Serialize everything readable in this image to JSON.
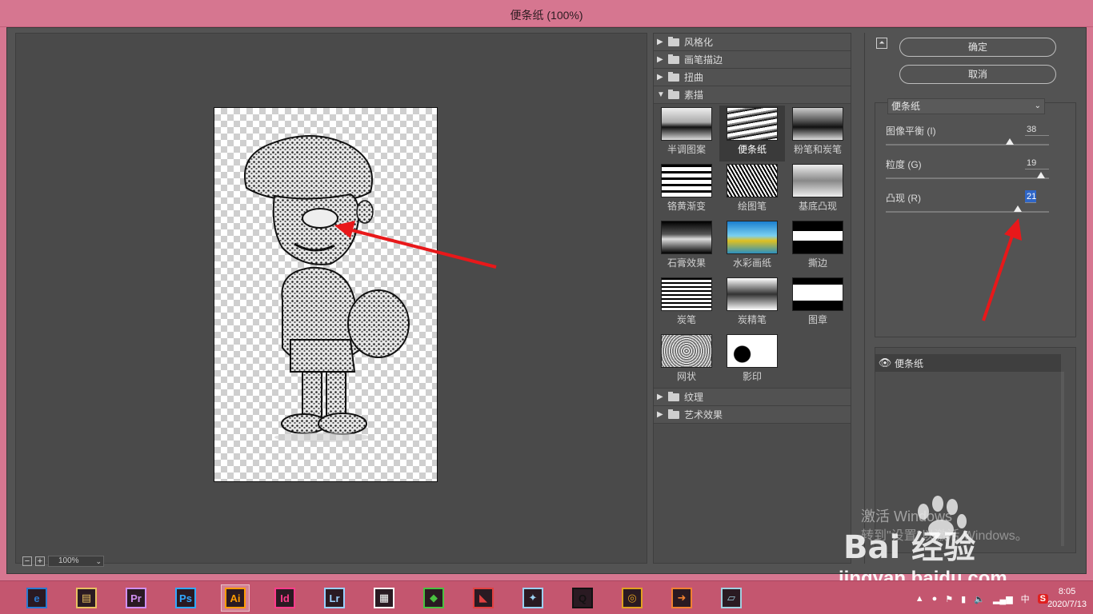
{
  "window": {
    "title": "便条纸 (100%)"
  },
  "preview": {
    "zoom": "100%",
    "zoom_out": "−",
    "zoom_in": "+"
  },
  "gallery": {
    "categories_top": [
      {
        "label": "风格化",
        "expanded": false
      },
      {
        "label": "画笔描边",
        "expanded": false
      },
      {
        "label": "扭曲",
        "expanded": false
      },
      {
        "label": "素描",
        "expanded": true
      }
    ],
    "filters": [
      {
        "label": "半调图案"
      },
      {
        "label": "便条纸",
        "selected": true
      },
      {
        "label": "粉笔和炭笔"
      },
      {
        "label": "铬黄渐变"
      },
      {
        "label": "绘图笔"
      },
      {
        "label": "基底凸现"
      },
      {
        "label": "石膏效果"
      },
      {
        "label": "水彩画纸"
      },
      {
        "label": "撕边"
      },
      {
        "label": "炭笔"
      },
      {
        "label": "炭精笔"
      },
      {
        "label": "图章"
      },
      {
        "label": "网状"
      },
      {
        "label": "影印"
      }
    ],
    "categories_bottom": [
      {
        "label": "纹理",
        "expanded": false
      },
      {
        "label": "艺术效果",
        "expanded": false
      }
    ]
  },
  "panel": {
    "ok_label": "确定",
    "cancel_label": "取消",
    "collapse_glyph": "⏶",
    "filter_select": "便条纸",
    "params": [
      {
        "label": "图像平衡 (I)",
        "value": "38",
        "fraction": 0.76
      },
      {
        "label": "粒度 (G)",
        "value": "19",
        "fraction": 0.95
      },
      {
        "label": "凸现 (R)",
        "value": "21",
        "fraction": 0.81,
        "active": true
      }
    ],
    "layer": {
      "name": "便条纸",
      "visible": true
    }
  },
  "watermark": {
    "activate": "激活 Windows",
    "activate_sub": "转到\"设置\"以激活 Windows。",
    "brand": "Bai  经验",
    "url": "jingyan.baidu.com"
  },
  "taskbar": {
    "apps": [
      {
        "name": "browser-360",
        "label": "e",
        "color": "#2a7ad0"
      },
      {
        "name": "file-explorer",
        "label": "▤",
        "color": "#e8c060"
      },
      {
        "name": "premiere",
        "label": "Pr",
        "color": "#d08ff0"
      },
      {
        "name": "photoshop",
        "label": "Ps",
        "color": "#31a8ff"
      },
      {
        "name": "illustrator",
        "label": "Ai",
        "color": "#ff9a00",
        "active": true
      },
      {
        "name": "indesign",
        "label": "Id",
        "color": "#ff3a8a"
      },
      {
        "name": "lightroom",
        "label": "Lr",
        "color": "#9ad0ff"
      },
      {
        "name": "video-editor",
        "label": "▦",
        "color": "#ffffff"
      },
      {
        "name": "green-app",
        "label": "◆",
        "color": "#4ac040"
      },
      {
        "name": "red-app",
        "label": "◣",
        "color": "#e04040"
      },
      {
        "name": "bird-app",
        "label": "✦",
        "color": "#9ad0f0"
      },
      {
        "name": "qq",
        "label": "Q",
        "color": "#111111"
      },
      {
        "name": "chrome",
        "label": "◎",
        "color": "#e0a020"
      },
      {
        "name": "orange-app",
        "label": "➜",
        "color": "#f08030"
      },
      {
        "name": "notes-app",
        "label": "▱",
        "color": "#a0d0e0"
      }
    ],
    "tray": {
      "ime": "中",
      "time": "8:05",
      "date": "2020/7/13"
    }
  }
}
